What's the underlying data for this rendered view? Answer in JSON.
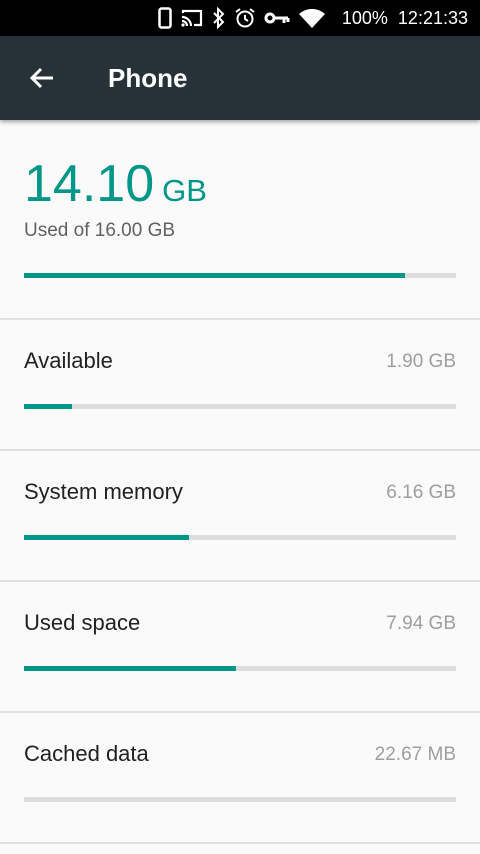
{
  "status_bar": {
    "battery": "100%",
    "time": "12:21:33",
    "icons": [
      "phone-icon",
      "cast-icon",
      "bluetooth-icon",
      "alarm-icon",
      "vpn-key-icon",
      "wifi-icon"
    ]
  },
  "app_bar": {
    "title": "Phone",
    "back_icon": "arrow-back-icon",
    "color": "#263238"
  },
  "summary": {
    "used_value": "14.10",
    "used_unit": "GB",
    "used_of": "Used of 16.00 GB",
    "progress": 0.8813
  },
  "accent_color": "#009688",
  "items": [
    {
      "label": "Available",
      "value": "1.90 GB",
      "progress": 0.111
    },
    {
      "label": "System memory",
      "value": "6.16 GB",
      "progress": 0.382
    },
    {
      "label": "Used space",
      "value": "7.94 GB",
      "progress": 0.491
    },
    {
      "label": "Cached data",
      "value": "22.67 MB",
      "progress": 0.0
    }
  ]
}
